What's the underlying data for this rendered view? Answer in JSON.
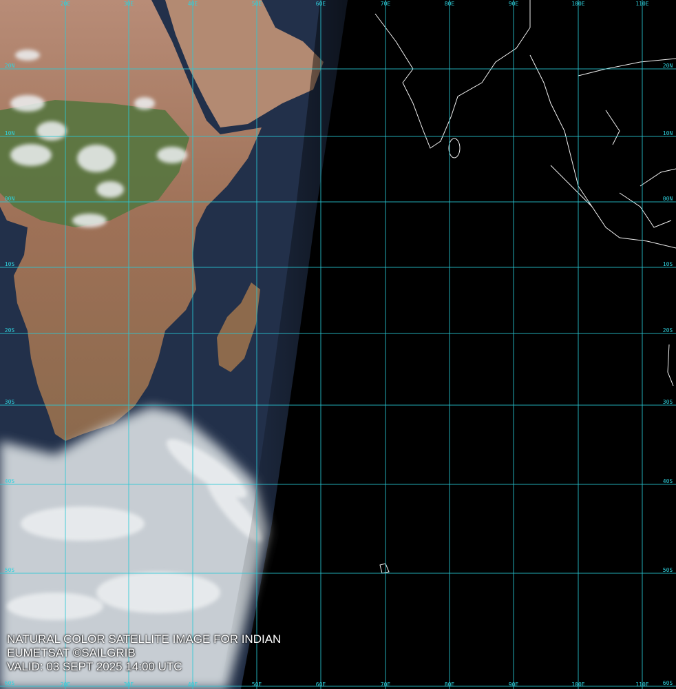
{
  "caption": {
    "line1": "NATURAL COLOR SATELLITE IMAGE FOR INDIAN",
    "line2": "EUMETSAT ©SAILGRIB",
    "line3": "VALID:  03 SEPT 2025 14:00 UTC"
  },
  "grid": {
    "longitude_labels": [
      "20E",
      "30E",
      "40E",
      "50E",
      "60E",
      "70E",
      "80E",
      "90E",
      "100E",
      "110E"
    ],
    "latitude_labels": [
      "20N",
      "10N",
      "00N",
      "10S",
      "20S",
      "30S",
      "40S",
      "50S",
      "60S"
    ]
  },
  "colors": {
    "grid": "#29c9d6",
    "land": "#a87b62",
    "vegetation": "#55753f",
    "ocean_day": "#1f2c45",
    "night": "#000000",
    "cloud": "#e8ecef"
  }
}
